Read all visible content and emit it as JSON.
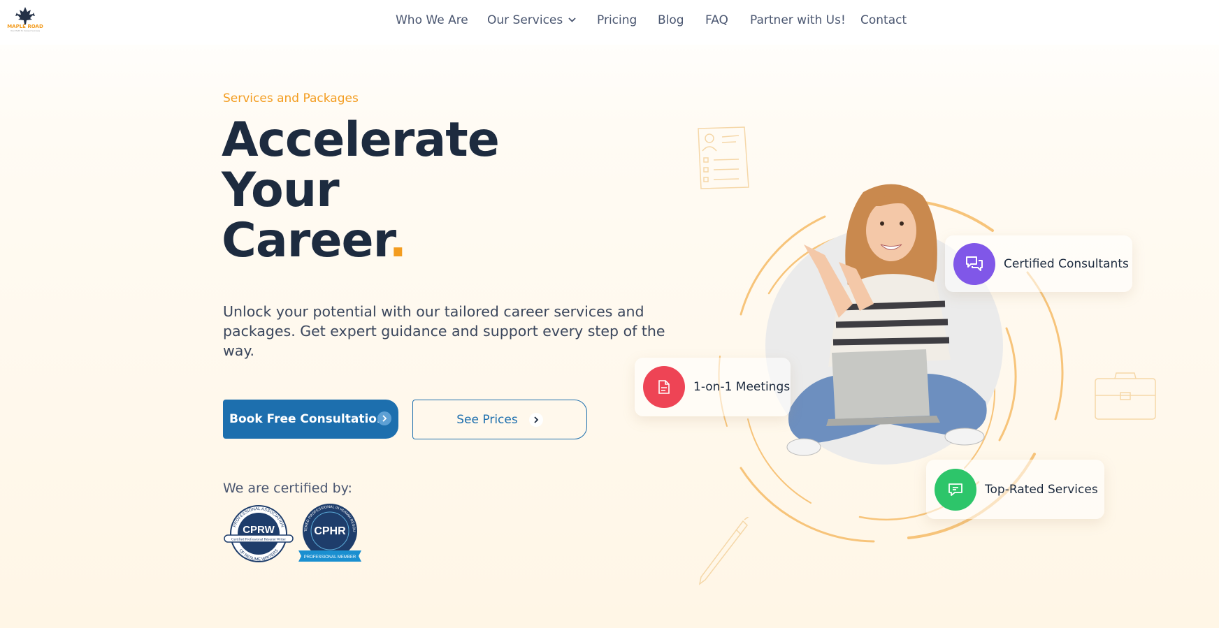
{
  "brand": {
    "logo_text": "MAPLE ROAD",
    "logo_subtext": "Your Path To Career Success",
    "accent_color": "#f39c1f",
    "primary_color": "#1d6fae"
  },
  "nav": {
    "items": [
      {
        "label": "Who We Are"
      },
      {
        "label": "Our Services",
        "has_dropdown": true
      },
      {
        "label": "Pricing"
      },
      {
        "label": "Blog"
      },
      {
        "label": "FAQ"
      },
      {
        "label": "Partner with Us!"
      },
      {
        "label": "Contact"
      }
    ]
  },
  "hero": {
    "eyebrow": "Services and Packages",
    "headline": {
      "line1": "Accelerate",
      "line2": "Your",
      "line3": "Career",
      "dot": "."
    },
    "description": "Unlock your potential with our tailored career services and packages. Get expert guidance and support every step of the way.",
    "primary_button": "Book Free Consultation",
    "secondary_button": "See Prices",
    "certified_label": "We are certified by:"
  },
  "certifications": [
    {
      "name": "CPRW",
      "top_text": "PROFESSIONAL ASSOCIATION",
      "ribbon": "Certified Professional Résumé Writer",
      "bottom_text": "OF RESUME WRITERS",
      "icon": "cprw-badge"
    },
    {
      "name": "CPHR",
      "top_text": "CHARTERED PROFESSIONAL IN HUMAN RESOURCES",
      "ribbon": "PROFESSIONAL MEMBER",
      "icon": "cphr-badge"
    }
  ],
  "feature_cards": [
    {
      "label": "Certified Consultants",
      "icon": "chat-bubbles-icon",
      "color": "#8057e8"
    },
    {
      "label": "1-on-1 Meetings",
      "icon": "document-icon",
      "color": "#ee4455"
    },
    {
      "label": "Top-Rated Services",
      "icon": "message-icon",
      "color": "#2dc56a"
    }
  ]
}
